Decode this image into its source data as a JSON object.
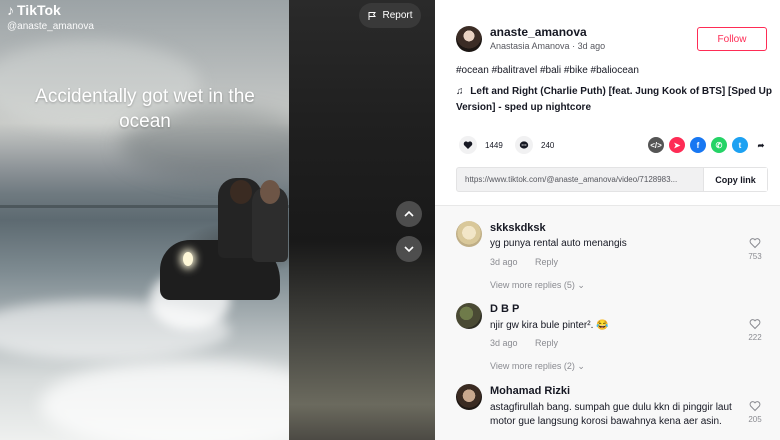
{
  "video": {
    "brand": "TikTok",
    "handle": "@anaste_amanova",
    "overlay_caption": "Accidentally got wet in the ocean",
    "report_label": "Report"
  },
  "author": {
    "username": "anaste_amanova",
    "display_name": "Anastasia Amanova",
    "posted": "3d ago",
    "follow_label": "Follow"
  },
  "post": {
    "hashtags": "#ocean #balitravel #bali #bike #baliocean",
    "music": "Left and Right (Charlie Puth) [feat. Jung Kook of BTS] [Sped Up Version] - sped up nightcore",
    "likes": "1449",
    "comments": "240",
    "link": "https://www.tiktok.com/@anaste_amanova/video/7128983...",
    "copy_label": "Copy link"
  },
  "colors": {
    "accent": "#fe2c55",
    "facebook": "#1877f2",
    "whatsapp": "#25d366",
    "twitter": "#1da1f2"
  },
  "comments_list": [
    {
      "user": "skkskdksk",
      "text": "yg punya rental auto menangis",
      "age": "3d ago",
      "reply_label": "Reply",
      "likes": "753",
      "view_more": "View more replies (5)"
    },
    {
      "user": "D B P",
      "text": "njir gw kira bule pinter². 😂",
      "age": "3d ago",
      "reply_label": "Reply",
      "likes": "222",
      "view_more": "View more replies (2)"
    },
    {
      "user": "Mohamad Rizki",
      "text": "astagfirullah bang. sumpah gue dulu kkn di pinggir laut motor gue langsung korosi bawahnya kena aer asin.",
      "likes": "205"
    }
  ]
}
